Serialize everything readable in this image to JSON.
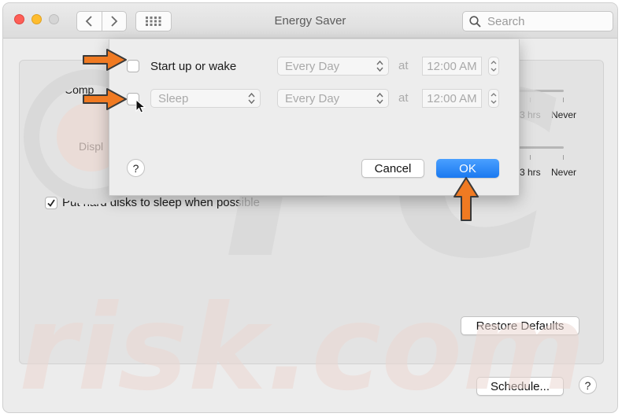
{
  "window": {
    "title": "Energy Saver",
    "search_placeholder": "Search"
  },
  "background": {
    "computer_label_partial": "Comp",
    "display_label_partial": "Displ",
    "slider_labels": [
      "3 hrs",
      "Never"
    ],
    "hard_disks_label": "Put hard disks to sleep when possible",
    "hard_disks_checked": true,
    "restore_defaults_label": "Restore Defaults",
    "schedule_label": "Schedule...",
    "help_label": "?"
  },
  "sheet": {
    "row1": {
      "checked": false,
      "label": "Start up or wake",
      "frequency": "Every Day",
      "at": "at",
      "time": "12:00 AM"
    },
    "row2": {
      "checked": false,
      "action": "Sleep",
      "frequency": "Every Day",
      "at": "at",
      "time": "12:00 AM"
    },
    "help_label": "?",
    "cancel_label": "Cancel",
    "ok_label": "OK"
  },
  "watermark": {
    "line1": "PC",
    "line2": "risk.com"
  },
  "colors": {
    "accent": "#1a79f0",
    "annotation_arrow": "#f07a22",
    "close": "#fd5f57",
    "minimize": "#febc2e"
  }
}
